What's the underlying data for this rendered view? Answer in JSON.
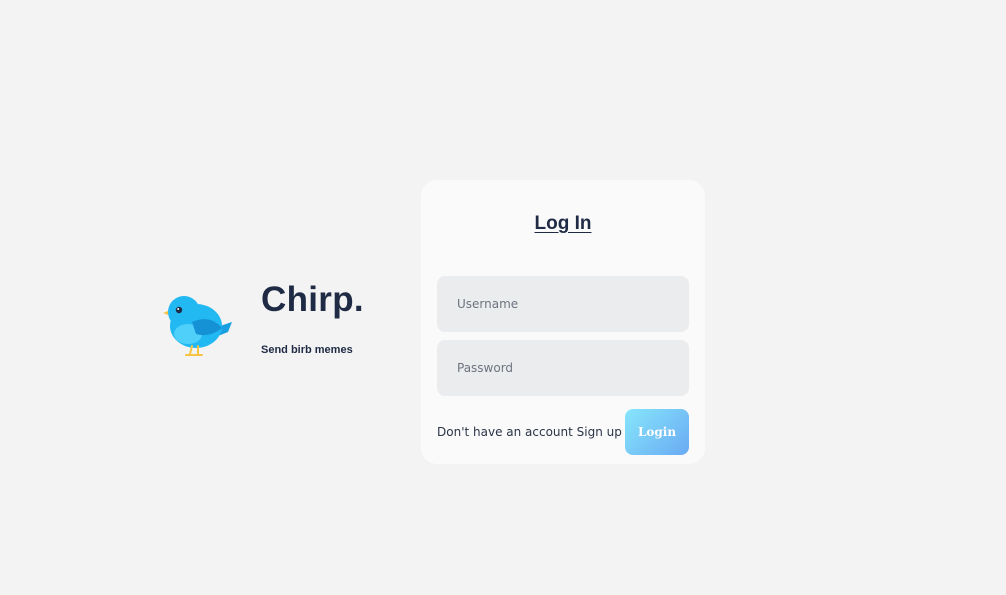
{
  "brand": {
    "name": "Chirp.",
    "tagline": "Send birb memes",
    "logo_icon": "bird-icon"
  },
  "login_card": {
    "title": "Log In",
    "username_placeholder": "Username",
    "password_placeholder": "Password",
    "signup_prompt": "Don't have an account",
    "signup_link": "Sign up",
    "login_label": "Login"
  },
  "colors": {
    "background": "#f3f3f3",
    "card": "#fafafa",
    "text": "#1f2a44",
    "input_bg": "#ebecee",
    "login_gradient_start": "#86e6fb",
    "login_gradient_end": "#6aaaf3",
    "bird_blue": "#1fb6f1"
  }
}
